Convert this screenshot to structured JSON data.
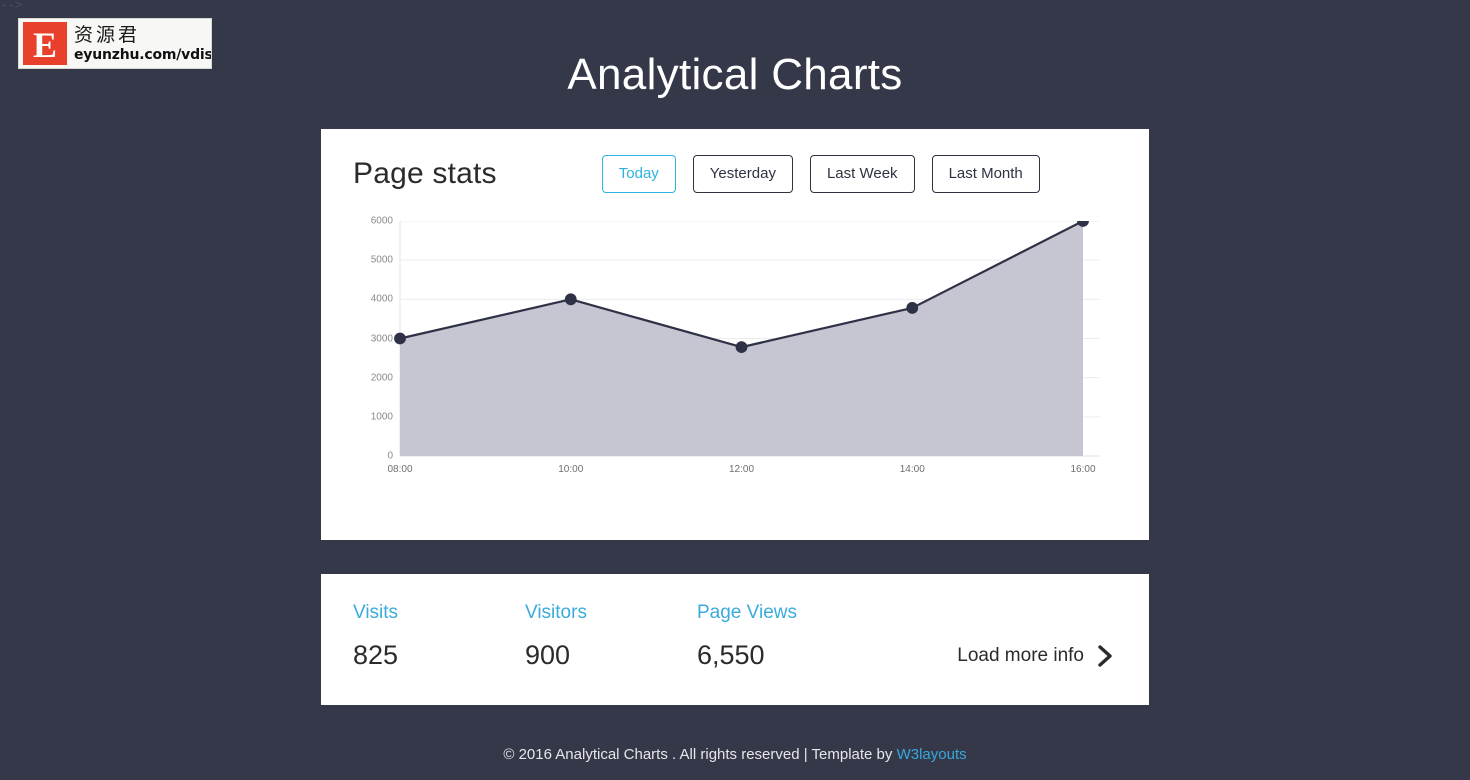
{
  "artifact": {
    "text": "-->"
  },
  "watermark": {
    "badge_letter": "E",
    "cn_text": "资源君",
    "url_text": "eyunzhu.com/vdisk"
  },
  "header": {
    "title": "Analytical Charts"
  },
  "chart_card": {
    "heading": "Page stats",
    "range_buttons": [
      {
        "label": "Today",
        "active": true
      },
      {
        "label": "Yesterday",
        "active": false
      },
      {
        "label": "Last Week",
        "active": false
      },
      {
        "label": "Last Month",
        "active": false
      }
    ]
  },
  "chart_data": {
    "type": "area",
    "title": "Page stats",
    "xlabel": "",
    "ylabel": "",
    "x": [
      "08:00",
      "10:00",
      "12:00",
      "14:00",
      "16:00"
    ],
    "categories": [
      "08:00",
      "10:00",
      "12:00",
      "14:00",
      "16:00"
    ],
    "values": [
      3000,
      4000,
      2780,
      3780,
      6000
    ],
    "series": [
      {
        "name": "Page stats",
        "values": [
          3000,
          4000,
          2780,
          3780,
          6000
        ]
      }
    ],
    "yticks": [
      0,
      1000,
      2000,
      3000,
      4000,
      5000,
      6000
    ],
    "ytick_labels": [
      "0",
      "1000",
      "2000",
      "3000",
      "4000",
      "5000",
      "6000"
    ],
    "ylim": [
      0,
      6000
    ],
    "grid": true,
    "legend": false,
    "line_color": "#2f3146",
    "area_color": "#c6c6d2",
    "marker_color": "#2f3146",
    "grid_color": "#ececf0"
  },
  "stats_card": {
    "items": [
      {
        "label": "Visits",
        "value": "825"
      },
      {
        "label": "Visitors",
        "value": "900"
      },
      {
        "label": "Page Views",
        "value": "6,550"
      }
    ],
    "load_more_label": "Load more info"
  },
  "footer": {
    "text": "© 2016 Analytical Charts . All rights reserved | Template by ",
    "link_label": "W3layouts"
  },
  "colors": {
    "background": "#353849",
    "card": "#ffffff",
    "accent": "#2cb3e0",
    "stat_label": "#3aabdc",
    "text_dark": "#2b2b2b"
  }
}
